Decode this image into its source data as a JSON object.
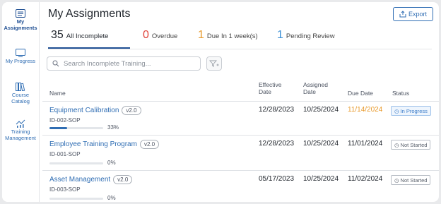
{
  "sidebar": {
    "items": [
      {
        "label_line1": "My",
        "label_line2": "Assignments"
      },
      {
        "label_line1": "My Progress",
        "label_line2": ""
      },
      {
        "label_line1": "Course",
        "label_line2": "Catalog"
      },
      {
        "label_line1": "Training",
        "label_line2": "Management"
      }
    ]
  },
  "header": {
    "title": "My Assignments",
    "export_label": "Export"
  },
  "tabs": [
    {
      "count": "35",
      "label": "All Incomplete"
    },
    {
      "count": "0",
      "label": "Overdue"
    },
    {
      "count": "1",
      "label": "Due In 1 week(s)"
    },
    {
      "count": "1",
      "label": "Pending Review"
    }
  ],
  "search": {
    "placeholder": "Search Incomplete Training..."
  },
  "table": {
    "headers": {
      "name": "Name",
      "effective_line1": "Effective",
      "effective_line2": "Date",
      "assigned_line1": "Assigned",
      "assigned_line2": "Date",
      "due": "Due Date",
      "status": "Status"
    },
    "rows": [
      {
        "name": "Equipment Calibration",
        "version": "v2.0",
        "code": "ID-002-SOP",
        "progress": 33,
        "progress_label": "33%",
        "effective": "12/28/2023",
        "assigned": "10/25/2024",
        "due": "11/14/2024",
        "status": "In Progress"
      },
      {
        "name": "Employee Training Program",
        "version": "v2.0",
        "code": "ID-001-SOP",
        "progress": 0,
        "progress_label": "0%",
        "effective": "12/28/2023",
        "assigned": "10/25/2024",
        "due": "11/01/2024",
        "status": "Not Started"
      },
      {
        "name": "Asset Management",
        "version": "v2.0",
        "code": "ID-003-SOP",
        "progress": 0,
        "progress_label": "0%",
        "effective": "05/17/2023",
        "assigned": "10/25/2024",
        "due": "11/02/2024",
        "status": "Not Started"
      }
    ]
  },
  "colors": {
    "accent": "#2f6db3",
    "overdue": "#e0433a",
    "due_soon": "#e89a2c",
    "pending": "#3a8fd6",
    "due_highlight": "#e89a2c"
  }
}
